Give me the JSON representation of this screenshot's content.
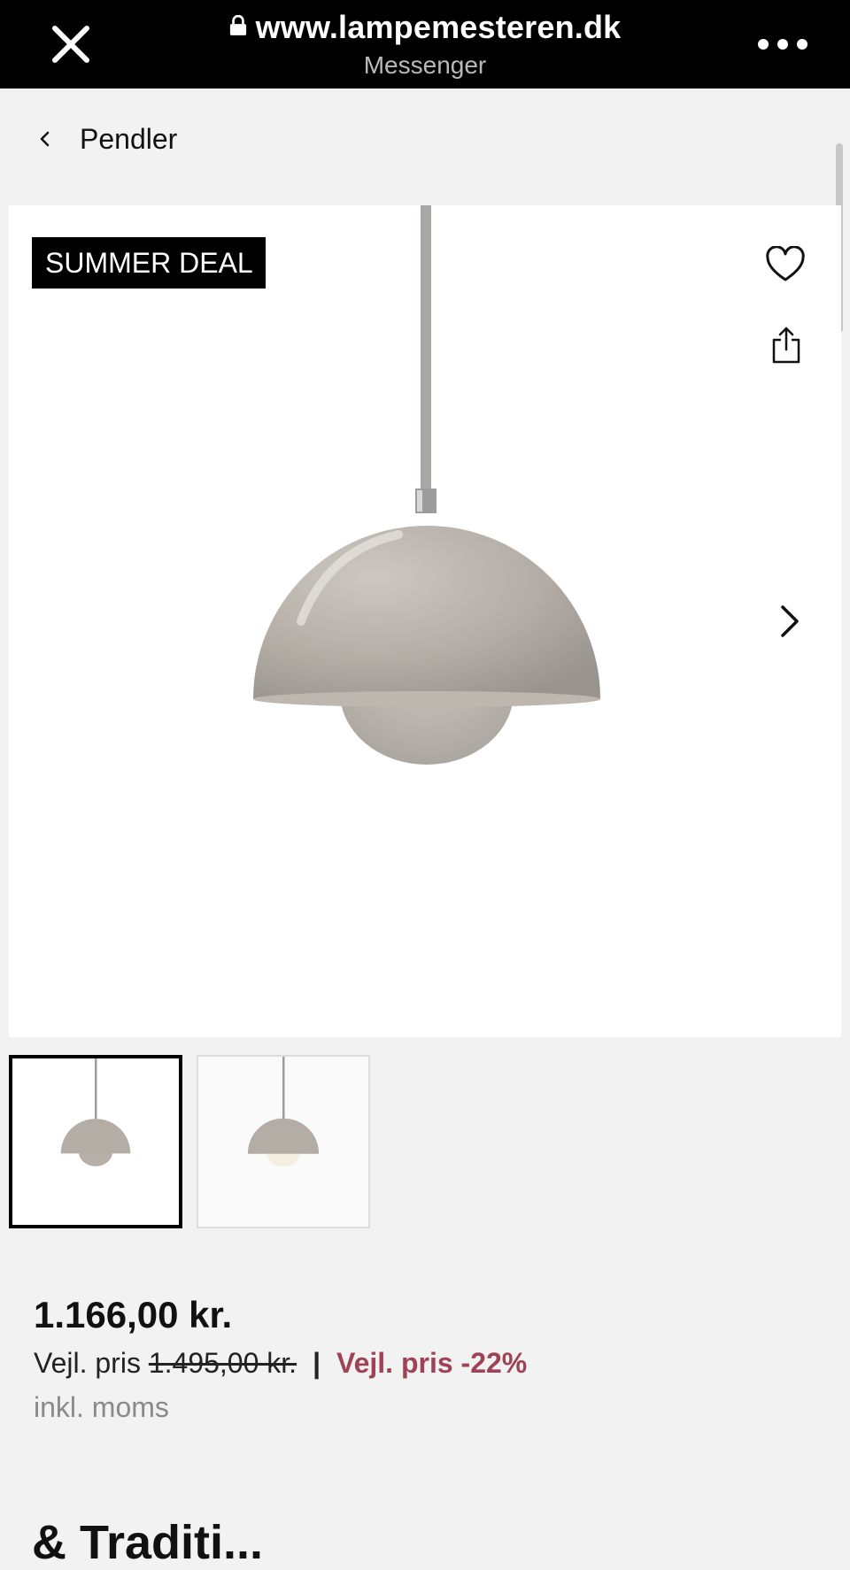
{
  "browser": {
    "url": "www.lampemesteren.dk",
    "source_app": "Messenger"
  },
  "nav": {
    "back_label": "Pendler"
  },
  "product": {
    "badge": "SUMMER DEAL",
    "price": "1.166,00 kr.",
    "rrp_label": "Vejl. pris",
    "rrp_value": "1.495,00 kr.",
    "separator": "|",
    "discount_label": "Vejl. pris -22%",
    "vat_note": "inkl. moms",
    "discount_color": "#a04256"
  },
  "gallery": {
    "thumbnails": [
      {
        "alt": "Pendant lamp grey",
        "selected": true
      },
      {
        "alt": "Pendant lamp grey lit",
        "selected": false
      }
    ]
  },
  "section": {
    "title_partial": "& Traditi..."
  }
}
